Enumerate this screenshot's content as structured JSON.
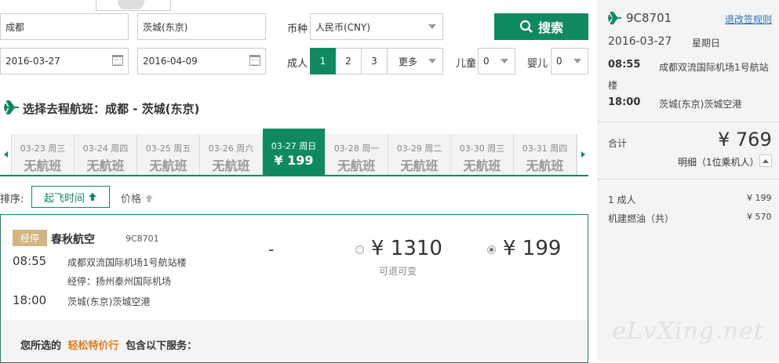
{
  "search": {
    "from_city": "成都",
    "to_city": "茨城(东京)",
    "depart_date": "2016-03-27",
    "return_date": "2016-04-09",
    "currency_label": "币种",
    "currency_value": "人民币(CNY)",
    "search_button": "搜索",
    "adult_label": "成人",
    "adult_options": [
      "1",
      "2",
      "3"
    ],
    "more_label": "更多",
    "child_label": "儿童",
    "child_value": "0",
    "infant_label": "婴儿",
    "infant_value": "0"
  },
  "section_title": "选择去程航班：成都 - 茨城(东京)",
  "date_tabs": [
    {
      "date": "03-23 周三",
      "price": "无航班"
    },
    {
      "date": "03-24 周四",
      "price": "无航班"
    },
    {
      "date": "03-25 周五",
      "price": "无航班"
    },
    {
      "date": "03-26 周六",
      "price": "无航班"
    },
    {
      "date": "03-27 周日",
      "price": "¥ 199",
      "active": true
    },
    {
      "date": "03-28 周一",
      "price": "无航班"
    },
    {
      "date": "03-29 周二",
      "price": "无航班"
    },
    {
      "date": "03-30 周三",
      "price": "无航班"
    },
    {
      "date": "03-31 周四",
      "price": "无航班"
    }
  ],
  "sort": {
    "label": "排序:",
    "by_time": "起飞时间",
    "by_price": "价格"
  },
  "flight": {
    "stop_badge": "经停",
    "airline": "春秋航空",
    "flight_no": "9C8701",
    "dep_time": "08:55",
    "dep_airport": "成都双流国际机场1号航站楼",
    "stopover": "经停：扬州泰州国际机场",
    "arr_time": "18:00",
    "arr_airport": "茨城(东京)茨城空港",
    "dash": "-",
    "fare1_price": "¥ 1310",
    "fare1_note": "可退可变",
    "fare2_price": "¥ 199"
  },
  "service_note": {
    "prefix": "您所选的",
    "product": "轻松特价行",
    "suffix": "包含以下服务："
  },
  "sidebar": {
    "flight_no": "9C8701",
    "rules_link": "退改签规则",
    "date": "2016-03-27",
    "weekday": "星期日",
    "dep_time": "08:55",
    "dep_airport_line1": "成都双流国际机场1号航站",
    "dep_airport_line2": "楼",
    "arr_time": "18:00",
    "arr_airport": "茨城(东京)茨城空港",
    "total_label": "合计",
    "total_price": "¥ 769",
    "detail_label": "明细（1位乘机人）",
    "rows": [
      {
        "label": "1 成人",
        "value": "¥ 199"
      },
      {
        "label": "机建燃油（共）",
        "value": "¥ 570"
      }
    ]
  },
  "watermark": "eLvXing.net",
  "colors": {
    "brand_green": "#0f8a5f",
    "badge_tan": "#d4b483",
    "link_blue": "#2a6fb8"
  }
}
